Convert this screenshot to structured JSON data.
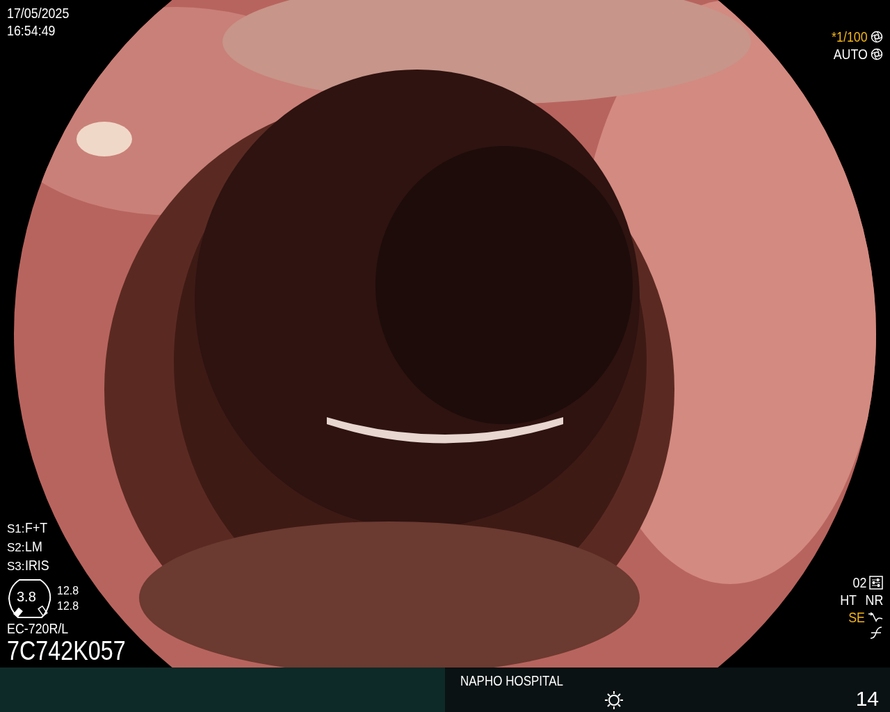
{
  "date": "17/05/2025",
  "time": "16:54:49",
  "exposure": [
    {
      "text": "*1/100",
      "highlighted": true
    },
    {
      "text": "AUTO",
      "highlighted": false
    }
  ],
  "switches": [
    {
      "label": "S1:",
      "value": "F+T"
    },
    {
      "label": "S2:",
      "value": "LM"
    },
    {
      "label": "S3:",
      "value": "IRIS"
    }
  ],
  "dial": {
    "value": "3.8",
    "readings": [
      "12.8",
      "12.8"
    ]
  },
  "scope": {
    "model": "EC-720R/L",
    "serial": "7C742K057"
  },
  "settings": {
    "preset": "02",
    "modes": [
      {
        "text": "HT",
        "highlighted": false
      },
      {
        "text": "NR",
        "highlighted": false
      }
    ],
    "enhancement": {
      "text": "SE",
      "highlighted": true
    }
  },
  "status_bar": {
    "hospital": "NAPHO HOSPITAL",
    "counter": "14"
  }
}
